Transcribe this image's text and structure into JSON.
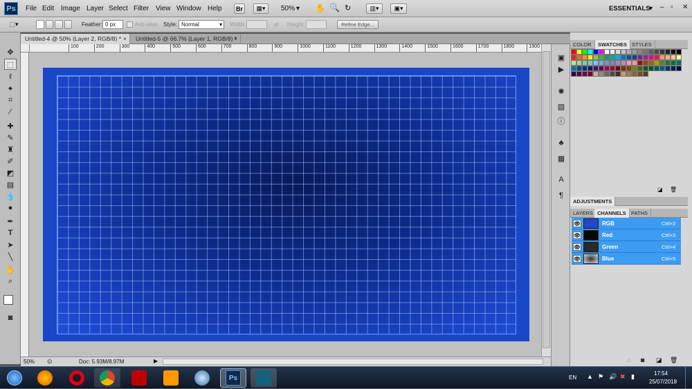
{
  "app": {
    "logo": "Ps",
    "workspace": "ESSENTIALS"
  },
  "menu": [
    "File",
    "Edit",
    "Image",
    "Layer",
    "Select",
    "Filter",
    "View",
    "Window",
    "Help"
  ],
  "topbar": {
    "zoom": "50%",
    "br_label": "Br"
  },
  "options": {
    "feather_label": "Feather:",
    "feather_value": "0 px",
    "antialias_label": "Anti-alias",
    "style_label": "Style:",
    "style_value": "Normal",
    "width_label": "Width:",
    "height_label": "Height:",
    "refine_label": "Refine Edge..."
  },
  "tabs": [
    {
      "label": "Untitled-4 @ 50% (Layer 2, RGB/8) *"
    },
    {
      "label": "Untitled-5 @ 66.7% (Layer 1, RGB/8) *"
    }
  ],
  "ruler": [
    "100",
    "200",
    "300",
    "400",
    "500",
    "600",
    "700",
    "800",
    "900",
    "1000",
    "1100",
    "1200",
    "1300",
    "1400",
    "1500",
    "1600",
    "1700",
    "1800",
    "1900"
  ],
  "status": {
    "zoom": "50%",
    "doc": "Doc: 5.93M/8.97M"
  },
  "panels": {
    "top_tabs": [
      "COLOR",
      "SWATCHES",
      "STYLES"
    ],
    "adjustments": "ADJUSTMENTS",
    "bottom_tabs": [
      "LAYERS",
      "CHANNELS",
      "PATHS"
    ]
  },
  "channels": [
    {
      "name": "RGB",
      "shortcut": "Ctrl+2"
    },
    {
      "name": "Red",
      "shortcut": "Ctrl+3"
    },
    {
      "name": "Green",
      "shortcut": "Ctrl+4"
    },
    {
      "name": "Blue",
      "shortcut": "Ctrl+5"
    }
  ],
  "swatch_colors": [
    "#ff0000",
    "#ffff00",
    "#00ff00",
    "#00ffff",
    "#0000ff",
    "#ff00ff",
    "#ffffff",
    "#ebebeb",
    "#d7d7d7",
    "#c3c3c3",
    "#afafaf",
    "#9b9b9b",
    "#878787",
    "#737373",
    "#5f5f5f",
    "#4b4b4b",
    "#373737",
    "#232323",
    "#0f0f0f",
    "#000000",
    "#ee1d24",
    "#f26522",
    "#f7941d",
    "#fff200",
    "#8dc63f",
    "#39b54a",
    "#00a651",
    "#00a99d",
    "#00aeef",
    "#0072bc",
    "#0054a6",
    "#2e3192",
    "#662d91",
    "#92278f",
    "#ec008c",
    "#ed145b",
    "#f69679",
    "#f9ad81",
    "#fdc689",
    "#fff799",
    "#c4df9b",
    "#a3d39c",
    "#82ca9c",
    "#7accc8",
    "#6dcff6",
    "#7da7d9",
    "#8393ca",
    "#8781bd",
    "#a187be",
    "#bd8cbf",
    "#f49ac2",
    "#f6989d",
    "#9e0b0f",
    "#a0410d",
    "#a3620a",
    "#aba000",
    "#598527",
    "#197b30",
    "#007236",
    "#00746b",
    "#0076a3",
    "#004a80",
    "#003471",
    "#1b1464",
    "#440e62",
    "#630460",
    "#9e005d",
    "#9e0039",
    "#790000",
    "#7b2e00",
    "#7d4900",
    "#827b00",
    "#406618",
    "#005e20",
    "#005826",
    "#005952",
    "#005b7f",
    "#003663",
    "#002157",
    "#0d004c",
    "#32004b",
    "#4b0049",
    "#7b0046",
    "#7a0026",
    "#c7b299",
    "#998675",
    "#736357",
    "#534741",
    "#37302d",
    "#c69c6d",
    "#a67c52",
    "#8c6239",
    "#754c24",
    "#603913"
  ],
  "clock": {
    "time": "17:54",
    "date": "25/07/2018",
    "lang": "EN"
  }
}
